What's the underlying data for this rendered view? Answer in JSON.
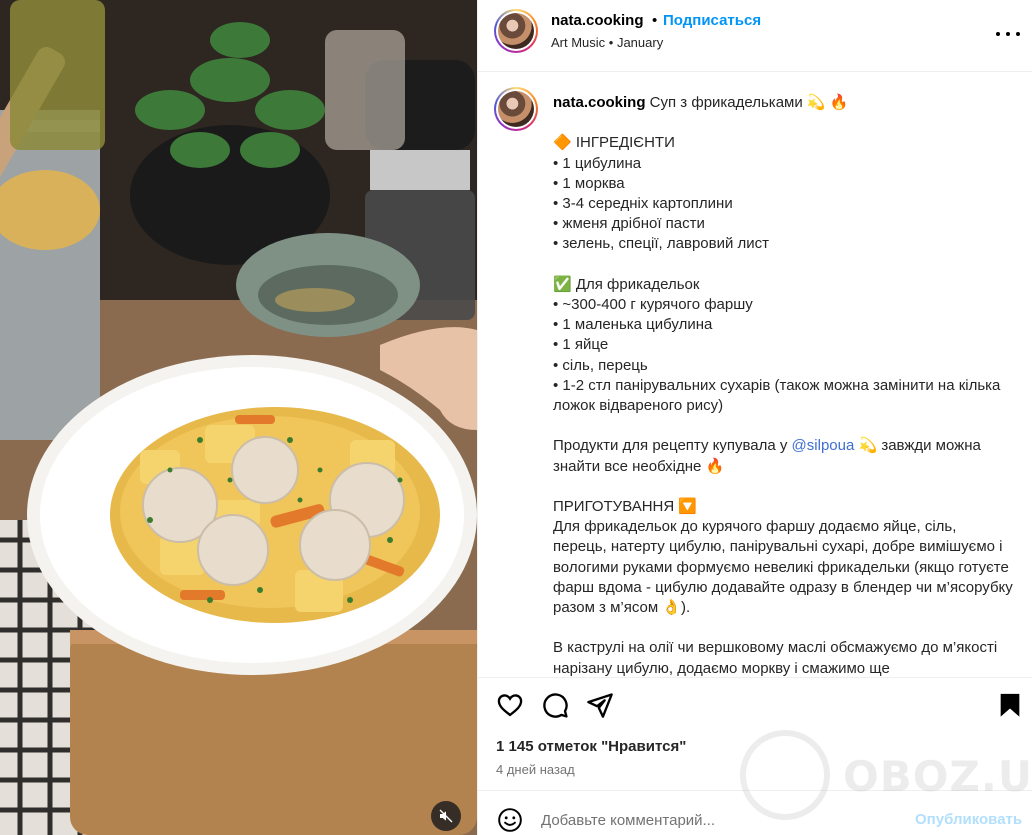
{
  "header": {
    "username": "nata.cooking",
    "separator": "•",
    "follow_label": "Подписаться",
    "subtitle": "Art Music • January"
  },
  "caption": {
    "username": "nata.cooking",
    "title": " Суп з фрикадельками 💫 🔥",
    "lines_before_mention": "\n\n🔶 ІНГРЕДІЄНТИ\n• 1 цибулина\n• 1 морква\n• 3-4 середніх картоплини\n• жменя дрібної пасти\n• зелень, спеції, лавровий лист\n\n✅ Для фрикадельок\n• ~300-400 г курячого фаршу\n• 1 маленька цибулина\n• 1 яйце\n• сіль, перець\n• 1-2 стл панірувальних сухарів (також можна замінити на кілька ложок відвареного рису)\n\nПродукти для рецепту купувала у ",
    "mention": "@silpoua",
    "lines_after_mention": " 💫 завжди можна знайти все необхідне 🔥\n\nПРИГОТУВАННЯ 🔽\nДля фрикадельок до курячого фаршу додаємо яйце, сіль, перець, натерту цибулю, панірувальні сухарі, добре вимішуємо і вологими руками формуємо невеликі фрикадельки (якщо готуєте фарш вдома - цибулю додавайте одразу в блендер чи м’ясорубку разом з м’ясом 👌).\n\nВ каструлі на олії чи вершковому маслі обсмажуємо до м’якості нарізану цибулю, додаємо моркву і смажимо ще"
  },
  "actions": {
    "likes_label": "1 145 отметок \"Нравится\"",
    "time_label": "4 дней назад"
  },
  "comment": {
    "placeholder": "Добавьте комментарий...",
    "publish_label": "Опубликовать"
  },
  "watermark": {
    "text": "OBOZ.UA"
  },
  "icons": {
    "heart": "heart-icon",
    "comment": "comment-icon",
    "share": "share-icon",
    "save": "bookmark-icon",
    "emoji": "emoji-icon",
    "more": "more-icon",
    "mute": "mute-icon"
  }
}
